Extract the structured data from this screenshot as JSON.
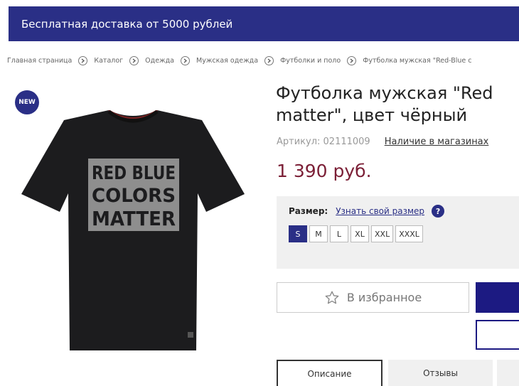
{
  "banner": {
    "text": "Бесплатная доставка от 5000 рублей"
  },
  "breadcrumb": [
    "Главная страница",
    "Каталог",
    "Одежда",
    "Мужская одежда",
    "Футболки и поло",
    "Футболка мужская \"Red-Blue c"
  ],
  "product": {
    "badge": "NEW",
    "title_line1": "Футболка мужская \"Red",
    "title_line2": "matter\", цвет чёрный",
    "sku": "Артикул: 02111009",
    "availability_link": "Наличие в магазинах",
    "price": "1 390 руб.",
    "print_lines": [
      "RED BLUE",
      "COLORS",
      "MATTER"
    ]
  },
  "sizes": {
    "label": "Размер:",
    "guide_link": "Узнать свой размер",
    "help_glyph": "?",
    "options": [
      "S",
      "M",
      "L",
      "XL",
      "XXL",
      "XXXL"
    ],
    "selected": "S"
  },
  "actions": {
    "favorite_label": "В избранное"
  },
  "tabs": [
    "Описание",
    "Отзывы"
  ],
  "colors": {
    "brand": "#2a2f86",
    "price": "#7b1f36",
    "buy": "#1c1a82"
  },
  "icons": {
    "breadcrumb_separator": "chevron-right-icon",
    "favorite": "star-outline-icon"
  }
}
